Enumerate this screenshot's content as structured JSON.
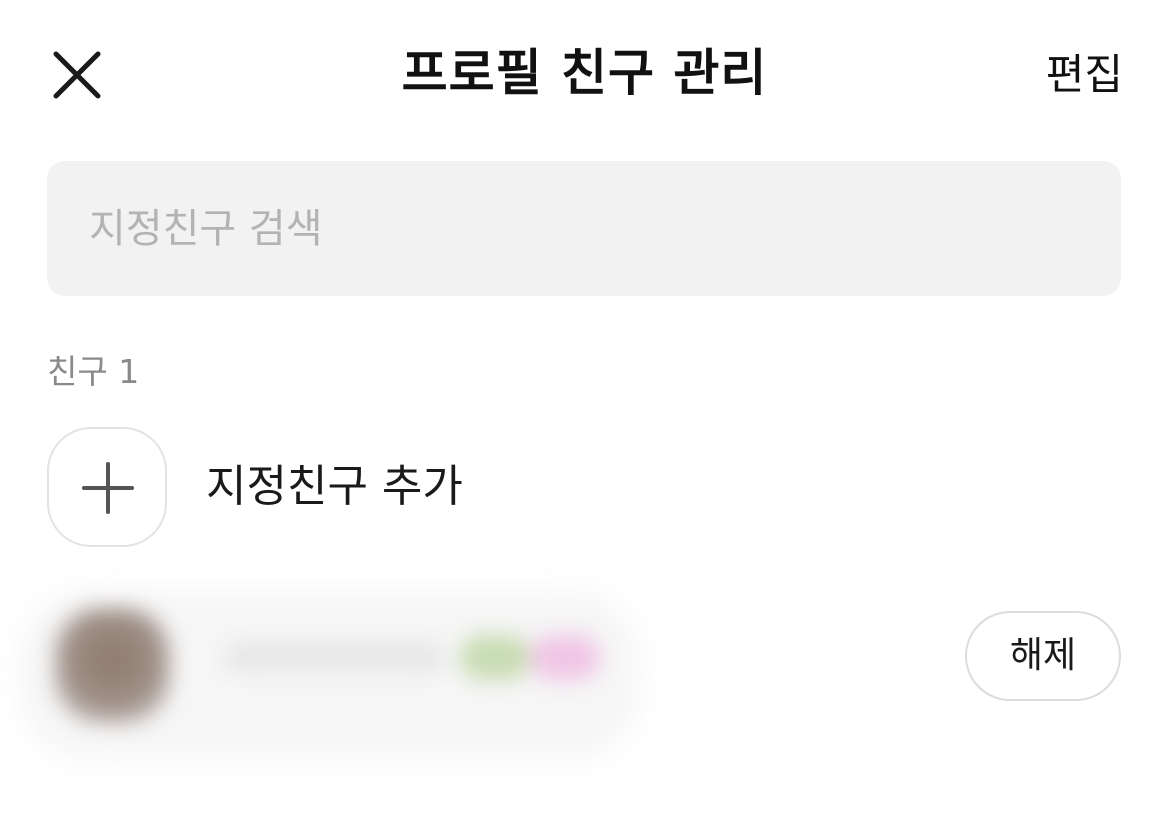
{
  "header": {
    "title": "프로필 친구 관리",
    "edit_label": "편집",
    "close_icon": "close-icon"
  },
  "search": {
    "placeholder": "지정친구 검색",
    "value": ""
  },
  "section": {
    "label": "친구 1"
  },
  "add_friend": {
    "label": "지정친구 추가",
    "icon": "plus-icon"
  },
  "friends": [
    {
      "name": "",
      "blurred": true,
      "action_label": "해제"
    }
  ],
  "colors": {
    "search_bg": "#f2f2f2",
    "placeholder": "#b3b3b3",
    "section_label": "#8a8a8a",
    "border": "#dcdcdc"
  }
}
